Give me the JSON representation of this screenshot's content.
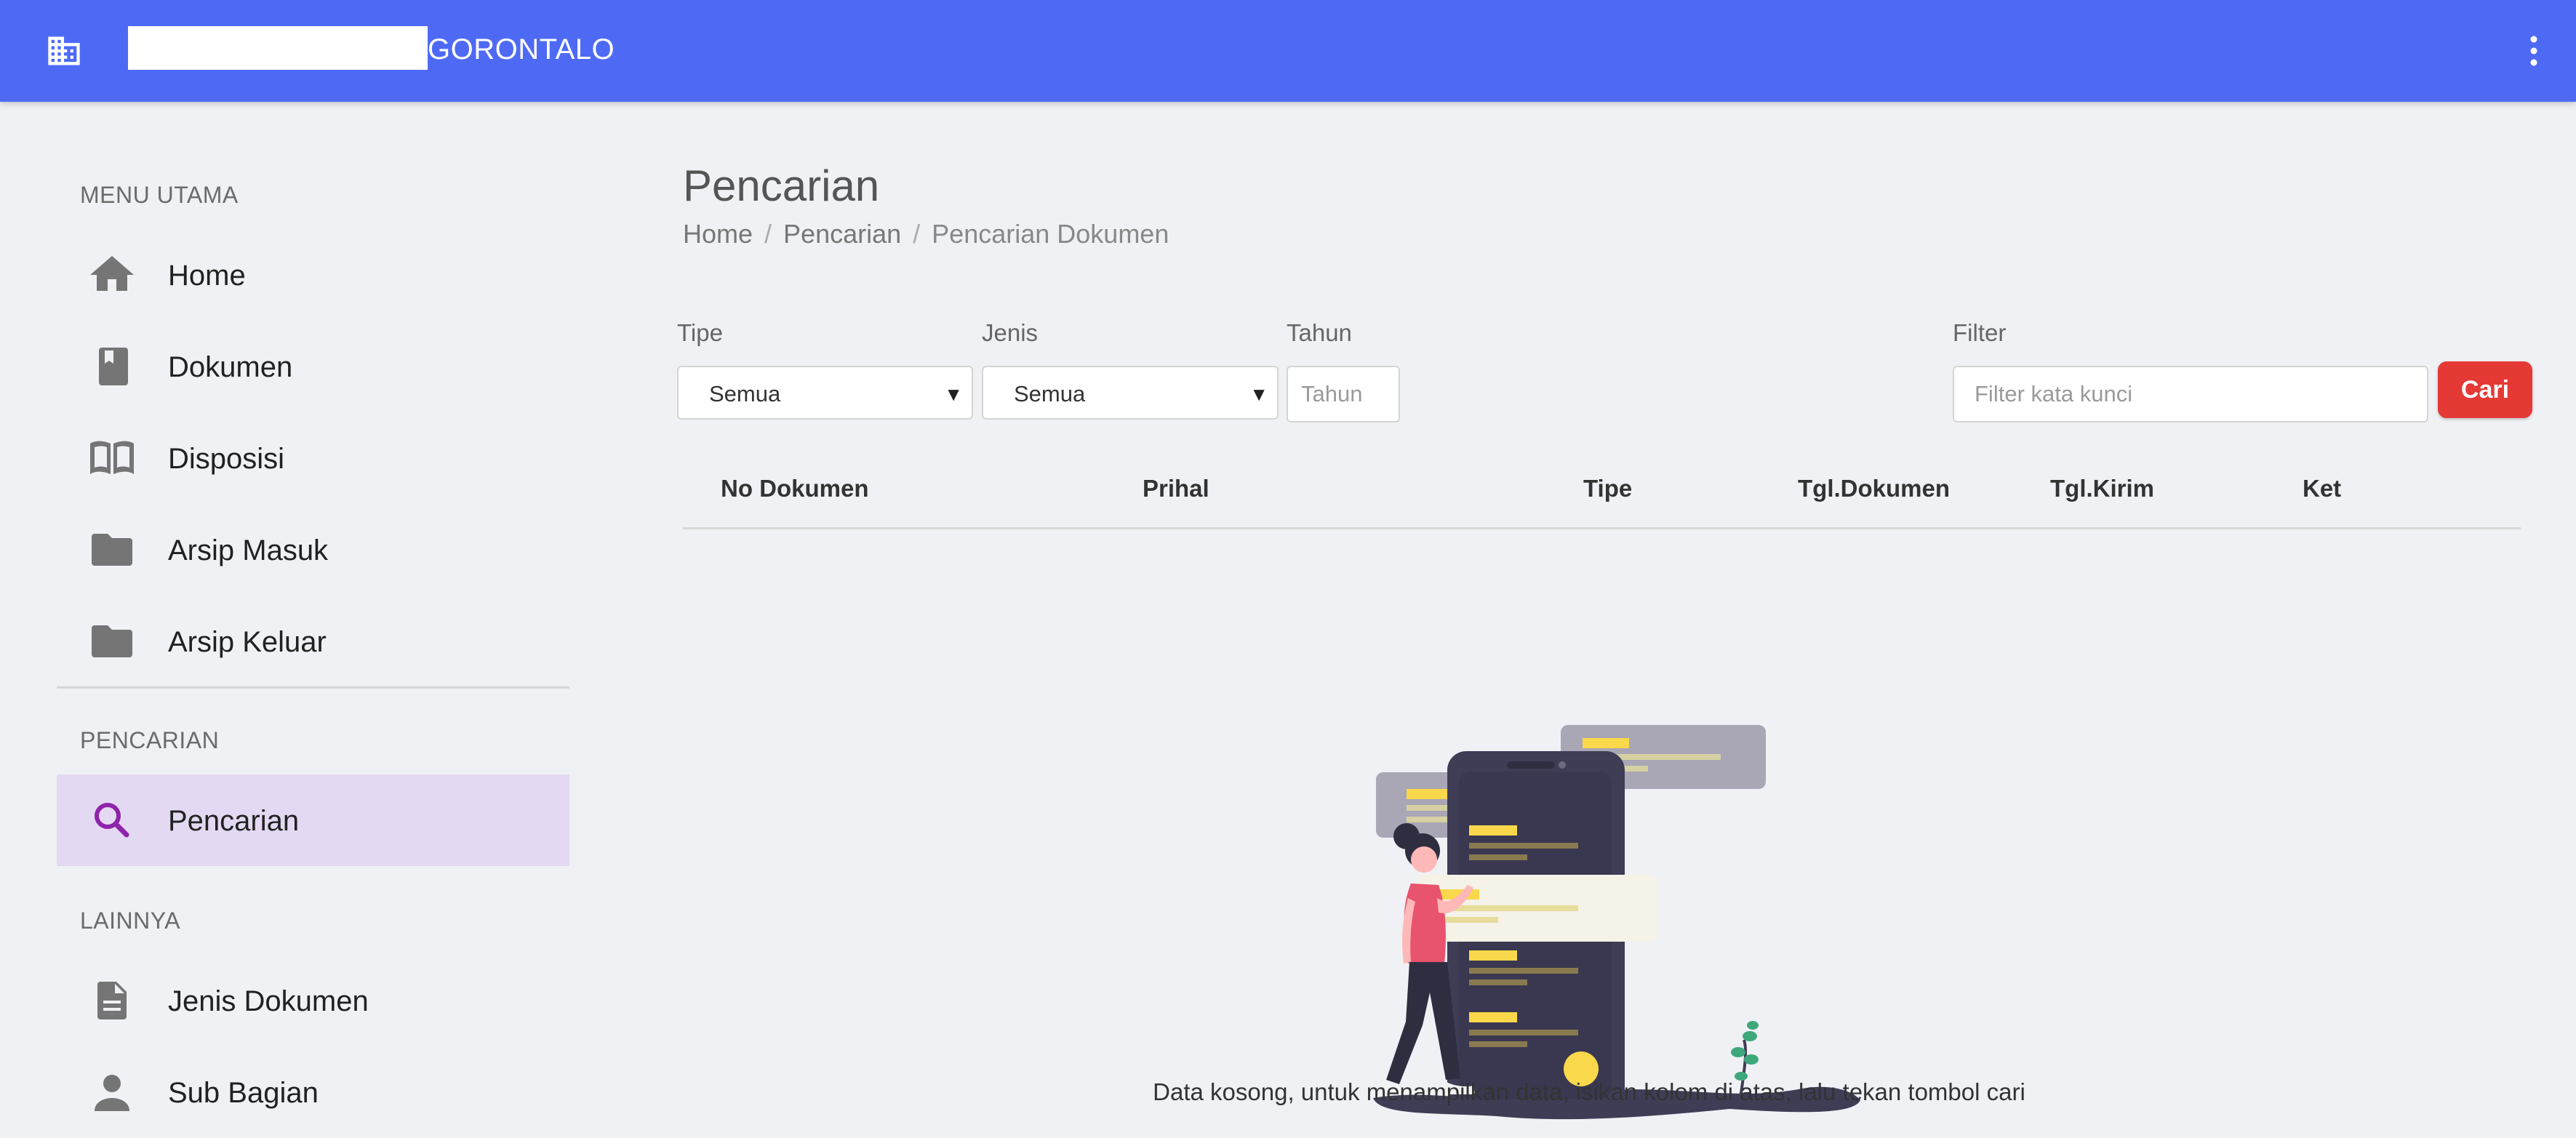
{
  "header": {
    "title": "GORONTALO",
    "building_icon": "building-icon",
    "more_icon": "more-vert-icon",
    "color": "#4e6af5"
  },
  "sidebar": {
    "sections": [
      {
        "title": "MENU UTAMA",
        "items": [
          {
            "label": "Home",
            "icon": "home-icon"
          },
          {
            "label": "Dokumen",
            "icon": "book-icon"
          },
          {
            "label": "Disposisi",
            "icon": "open-book-icon"
          },
          {
            "label": "Arsip Masuk",
            "icon": "folder-icon"
          },
          {
            "label": "Arsip Keluar",
            "icon": "folder-icon"
          }
        ]
      },
      {
        "title": "PENCARIAN",
        "items": [
          {
            "label": "Pencarian",
            "icon": "search-icon",
            "active": true
          }
        ]
      },
      {
        "title": "LAINNYA",
        "items": [
          {
            "label": "Jenis Dokumen",
            "icon": "description-icon"
          },
          {
            "label": "Sub Bagian",
            "icon": "person-icon"
          }
        ]
      }
    ],
    "active_color": "#e4d9f2"
  },
  "page": {
    "title": "Pencarian",
    "breadcrumb": [
      "Home",
      "Pencarian",
      "Pencarian Dokumen"
    ],
    "breadcrumb_sep": "/"
  },
  "filters": {
    "tipe": {
      "label": "Tipe",
      "value": "Semua"
    },
    "jenis": {
      "label": "Jenis",
      "value": "Semua"
    },
    "tahun": {
      "label": "Tahun",
      "placeholder": "Tahun"
    },
    "filter": {
      "label": "Filter",
      "placeholder": "Filter kata kunci"
    },
    "submit_label": "Cari",
    "submit_color": "#e53935"
  },
  "table": {
    "columns": [
      "No Dokumen",
      "Prihal",
      "Tipe",
      "Tgl.Dokumen",
      "Tgl.Kirim",
      "Ket"
    ],
    "rows": []
  },
  "empty_state": {
    "message": "Data kosong, untuk menampilkan data, isikan kolom di atas, lalu tekan tombol cari"
  }
}
